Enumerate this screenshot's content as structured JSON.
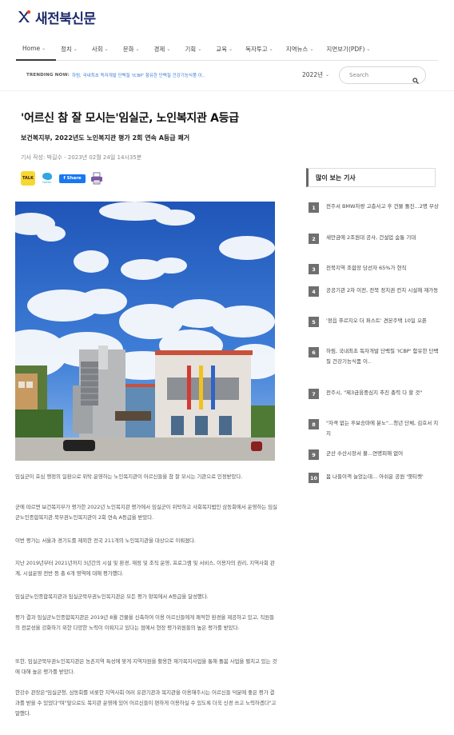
{
  "site": {
    "name": "새전북신문"
  },
  "nav": {
    "items": [
      {
        "label": "Home"
      },
      {
        "label": "정치"
      },
      {
        "label": "사회"
      },
      {
        "label": "문화"
      },
      {
        "label": "경제"
      },
      {
        "label": "기획"
      },
      {
        "label": "교육"
      },
      {
        "label": "독자투고"
      },
      {
        "label": "지역뉴스"
      },
      {
        "label": "지면보기(PDF)"
      }
    ]
  },
  "trending": {
    "label": "TRENDING NOW:",
    "text": "하림, 국내최초 독자개발 단백질 'ICBP' 함유한 단백질 건강기능식품 이.."
  },
  "year_select": {
    "value": "2022년"
  },
  "search": {
    "placeholder": "Search"
  },
  "article": {
    "title": "'어르신 참 잘 모시는'임실군, 노인복지관 A등급",
    "subtitle": "보건복지부, 2022년도 노인복지관 평가 2회 연속 A등급 쾌거",
    "byline": "기사 작성:  박길수  - 2023년 02월 24일 14시35분",
    "paragraphs": [
      "임실군이 효심 행정의 일환으로 위탁.운영하는 노인복지관이 어르신들을 참 잘 모시는 기관으로 인정받았다.",
      "군에 따르면 보건복지부가 평가한 2022년 노인복지관 평가에서 임실군이 위탁하고 사회복지법인 삼동회에서 운영하는 임실군노인종합복지관.북부권노인복지관이 2회 연속 A등급을 받았다.",
      "이번 평가는 서울과 경기도를 제외한 전국 211개의 노인복지관을 대상으로 이뤄졌다.",
      "지난 2019년부터 2021년까지 3년간의 시설 및 환경, 재정 및 조직 운영, 프로그램 및 서비스, 이용자의 권리, 지역사회 관계, 시설운영 전반 등 총 6개 영역에 대해 평가했다.",
      "임실군노인종합복지관과 임실군북부권노인복지관은 모든 평가 항목에서 A등급을 달성했다.",
      "평가 결과 임실군노인종합복지관은 2019년 8월 건물을 신축하여 이용 어르신들에게 쾌적한 환경을 제공하고 있고, 직원들의 전문성을 강화하기 위한 다양한 노력이 이뤄지고 있다는 점에서 현장 평가위원들의 높은 평가를 받았다.",
      "또한, 임실군북부권노인복지관은 농촌지역 특성에 맞게 지역자원을 활용한 재가복지사업을 통해 돌봄 사업을 펼치고 있는 것에 대해 높은 평가를 받았다.",
      "한강수 관장은\"임실군청, 삼동회를 비롯한 지역사회 여러 유관기관과 복지관을 이용해주시는 어르신들 덕분에 좋은 평가 결과를 받을 수 있었다\"며\"앞으로도 복지관 운영에 있어 어르신들이 편하게 이용하실 수 있도록 더욱 신경 쓰고 노력하겠다\"고 말했다."
    ]
  },
  "share": {
    "kakao": "TALK",
    "twitter": "twitter",
    "facebook": "f Share"
  },
  "sidebar": {
    "title": "많이 보는 기사",
    "items": [
      {
        "num": "1",
        "text": "전주서 BMW차량 고층사고 후 건물 돌진...2명 부상"
      },
      {
        "num": "2",
        "text": "새만금에 2조원대 공사, 건설업 숨통 기대"
      },
      {
        "num": "3",
        "text": "전북지역 조합장 당선자 65%가 현직"
      },
      {
        "num": "4",
        "text": "공공기관 2차 이전, 전북 정치권 컨치 시설해 재가동"
      },
      {
        "num": "5",
        "text": "'정읍 푸르지오 더 퍼스트' 견본주택 10일 오픈"
      },
      {
        "num": "6",
        "text": "하림, 국내최초 독자개발 단백질 'ICBP' 함유한 단백질 건강기능식품 이.."
      },
      {
        "num": "7",
        "text": "전주시, \"제3금융중심지 추진 총력 다 할 것\""
      },
      {
        "num": "8",
        "text": "\"자격 없는 후보승마에 분노\"...청년 단체, 김호서 지지"
      },
      {
        "num": "9",
        "text": "군산 수산시장서 불...연명피해 없어"
      },
      {
        "num": "10",
        "text": "봄 나들이객 늘었는데... 아쉬운 공원 '옛티켓'"
      }
    ]
  },
  "colors": {
    "brand": "#1d2a6b",
    "accent": "#3a7bd5",
    "rank_bg": "#6f6f6f"
  }
}
